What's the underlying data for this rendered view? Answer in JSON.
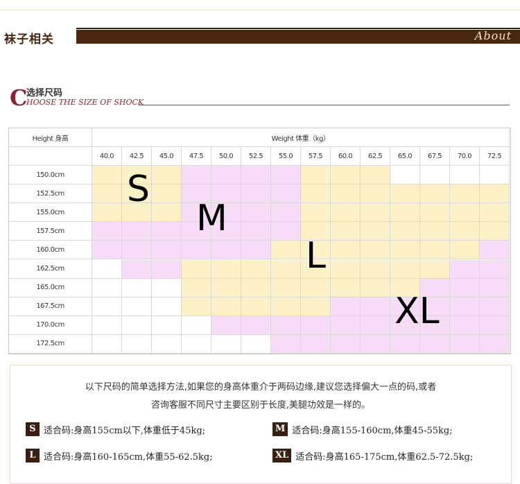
{
  "header": {
    "title": "袜子相关",
    "about": "About"
  },
  "section": {
    "initial": "C",
    "title_cn": "选择尺码",
    "title_en": "HOOSE THE SIZE OF SHOCK"
  },
  "table": {
    "height_header": "Height 身高",
    "weight_header": "Weight 体重（kg）",
    "weights": [
      "40.0",
      "42.5",
      "45.0",
      "47.5",
      "50.0",
      "52.5",
      "55.0",
      "57.5",
      "60.0",
      "62.5",
      "65.0",
      "67.5",
      "70.0",
      "72.5"
    ],
    "heights": [
      "150.0cm",
      "152.5cm",
      "155.0cm",
      "157.5cm",
      "160.0cm",
      "162.5cm",
      "165.0cm",
      "167.5cm",
      "170.0cm",
      "172.5cm"
    ],
    "grid": [
      "YYYPPPPYYYWWWW",
      "YYYPPPPYYYYYYY",
      "YYYPPPPYYYYYYY",
      "PPPPPPPYYYYYYY",
      "PPPPPPYYYYYYYP",
      "WPPYYYYYYYYYPP",
      "WWWYYYYYYYYPPP",
      "WWWYYYYYPPPPPP",
      "WWWWPPPPPPPPPP",
      "WWWWWWPPPPPPPP"
    ],
    "labels": {
      "S": "S",
      "M": "M",
      "L": "L",
      "XL": "XL"
    },
    "colors": {
      "yellow": "#fbf0c6",
      "pink": "#f7dcf7",
      "white": "#ffffff",
      "header_bg": "#ffffff"
    }
  },
  "info": {
    "line1": "以下尺码的简单选择方法,如果您的身高体重介于两码边缘,建议您选择偏大一点的码,或者",
    "line2": "咨询客服不同尺寸主要区别于长度,美腿功效是一样的。",
    "items": [
      {
        "badge": "S",
        "text": "适合码:身高155cm以下,体重低于45kg;"
      },
      {
        "badge": "M",
        "text": "适合码:身高155-160cm,体重45-55kg;"
      },
      {
        "badge": "L",
        "text": "适合码:身高160-165cm,体重55-62.5kg;"
      },
      {
        "badge": "XL",
        "text": "适合码:身高165-175cm,体重62.5-72.5kg;"
      }
    ]
  }
}
